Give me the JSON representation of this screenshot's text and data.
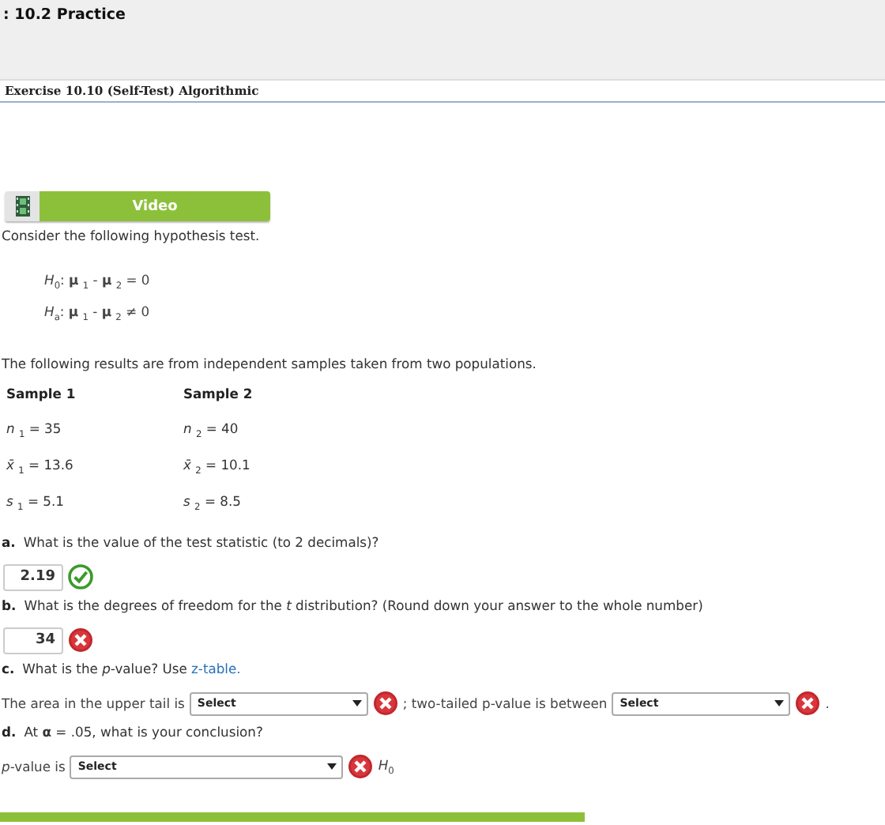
{
  "header": {
    "title": ": 10.2 Practice"
  },
  "exercise": {
    "title": "Exercise 10.10 (Self-Test) Algorithmic"
  },
  "video_button": {
    "label": "Video"
  },
  "intro": "Consider the following hypothesis test.",
  "hypotheses": [
    "*H*$_{0}$: **μ** $_{1}$ - **μ** $_{2}$ = 0",
    "*H*$_{a}$: **μ** $_{1}$ - **μ** $_{2}$ ≠ 0"
  ],
  "results_text": "The following results are from independent samples taken from two populations.",
  "samples": [
    {
      "heading": "Sample 1",
      "stats": [
        "*n* $_{1}$ = 35",
        "*x̄* $_{1}$ = 13.6",
        "*s* $_{1}$ = 5.1"
      ]
    },
    {
      "heading": "Sample 2",
      "stats": [
        "*n* $_{2}$ = 40",
        "*x̄* $_{2}$ = 10.1",
        "*s* $_{2}$ = 8.5"
      ]
    }
  ],
  "questions": [
    {
      "letter": "a.",
      "text": "What is the value of the test statistic (to 2 decimals)?",
      "parts": [
        {
          "kind": "input",
          "value": "2.19",
          "correct": true
        }
      ]
    },
    {
      "letter": "b.",
      "text": "What is the degrees of freedom for the *t* distribution? (Round down your answer to the whole number)",
      "parts": [
        {
          "kind": "input",
          "value": "34",
          "correct": false
        }
      ]
    },
    {
      "letter": "c.",
      "text": "What is the *p*-value? Use",
      "link": "z-table.",
      "parts": [
        {
          "kind": "text",
          "text": "The area in the upper tail is"
        },
        {
          "kind": "select",
          "value": "Select",
          "correct": false
        },
        {
          "kind": "text",
          "text": "; two-tailed p-value is between"
        },
        {
          "kind": "select",
          "value": "Select",
          "correct": false
        },
        {
          "kind": "text",
          "text": "."
        }
      ]
    },
    {
      "letter": "d.",
      "text": "At **α** = .05, what is your conclusion?",
      "parts": [
        {
          "kind": "text",
          "text": "*p*-value is"
        },
        {
          "kind": "select",
          "value": "Select",
          "correct": false,
          "wide": true
        },
        {
          "kind": "text",
          "text": "*H*$_{0}$"
        }
      ]
    }
  ]
}
